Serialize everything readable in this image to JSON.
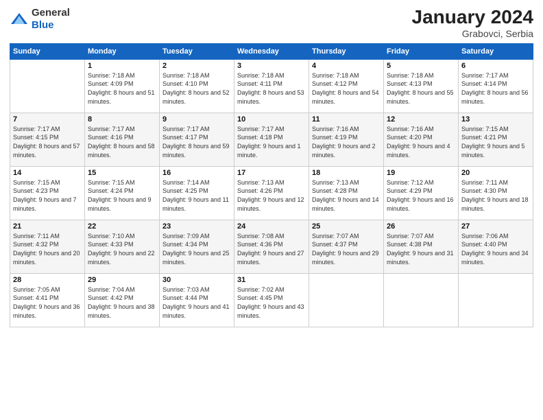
{
  "header": {
    "logo_general": "General",
    "logo_blue": "Blue",
    "month_year": "January 2024",
    "location": "Grabovci, Serbia"
  },
  "weekdays": [
    "Sunday",
    "Monday",
    "Tuesday",
    "Wednesday",
    "Thursday",
    "Friday",
    "Saturday"
  ],
  "weeks": [
    [
      {
        "day": "",
        "sunrise": "",
        "sunset": "",
        "daylight": ""
      },
      {
        "day": "1",
        "sunrise": "Sunrise: 7:18 AM",
        "sunset": "Sunset: 4:09 PM",
        "daylight": "Daylight: 8 hours and 51 minutes."
      },
      {
        "day": "2",
        "sunrise": "Sunrise: 7:18 AM",
        "sunset": "Sunset: 4:10 PM",
        "daylight": "Daylight: 8 hours and 52 minutes."
      },
      {
        "day": "3",
        "sunrise": "Sunrise: 7:18 AM",
        "sunset": "Sunset: 4:11 PM",
        "daylight": "Daylight: 8 hours and 53 minutes."
      },
      {
        "day": "4",
        "sunrise": "Sunrise: 7:18 AM",
        "sunset": "Sunset: 4:12 PM",
        "daylight": "Daylight: 8 hours and 54 minutes."
      },
      {
        "day": "5",
        "sunrise": "Sunrise: 7:18 AM",
        "sunset": "Sunset: 4:13 PM",
        "daylight": "Daylight: 8 hours and 55 minutes."
      },
      {
        "day": "6",
        "sunrise": "Sunrise: 7:17 AM",
        "sunset": "Sunset: 4:14 PM",
        "daylight": "Daylight: 8 hours and 56 minutes."
      }
    ],
    [
      {
        "day": "7",
        "sunrise": "Sunrise: 7:17 AM",
        "sunset": "Sunset: 4:15 PM",
        "daylight": "Daylight: 8 hours and 57 minutes."
      },
      {
        "day": "8",
        "sunrise": "Sunrise: 7:17 AM",
        "sunset": "Sunset: 4:16 PM",
        "daylight": "Daylight: 8 hours and 58 minutes."
      },
      {
        "day": "9",
        "sunrise": "Sunrise: 7:17 AM",
        "sunset": "Sunset: 4:17 PM",
        "daylight": "Daylight: 8 hours and 59 minutes."
      },
      {
        "day": "10",
        "sunrise": "Sunrise: 7:17 AM",
        "sunset": "Sunset: 4:18 PM",
        "daylight": "Daylight: 9 hours and 1 minute."
      },
      {
        "day": "11",
        "sunrise": "Sunrise: 7:16 AM",
        "sunset": "Sunset: 4:19 PM",
        "daylight": "Daylight: 9 hours and 2 minutes."
      },
      {
        "day": "12",
        "sunrise": "Sunrise: 7:16 AM",
        "sunset": "Sunset: 4:20 PM",
        "daylight": "Daylight: 9 hours and 4 minutes."
      },
      {
        "day": "13",
        "sunrise": "Sunrise: 7:15 AM",
        "sunset": "Sunset: 4:21 PM",
        "daylight": "Daylight: 9 hours and 5 minutes."
      }
    ],
    [
      {
        "day": "14",
        "sunrise": "Sunrise: 7:15 AM",
        "sunset": "Sunset: 4:23 PM",
        "daylight": "Daylight: 9 hours and 7 minutes."
      },
      {
        "day": "15",
        "sunrise": "Sunrise: 7:15 AM",
        "sunset": "Sunset: 4:24 PM",
        "daylight": "Daylight: 9 hours and 9 minutes."
      },
      {
        "day": "16",
        "sunrise": "Sunrise: 7:14 AM",
        "sunset": "Sunset: 4:25 PM",
        "daylight": "Daylight: 9 hours and 11 minutes."
      },
      {
        "day": "17",
        "sunrise": "Sunrise: 7:13 AM",
        "sunset": "Sunset: 4:26 PM",
        "daylight": "Daylight: 9 hours and 12 minutes."
      },
      {
        "day": "18",
        "sunrise": "Sunrise: 7:13 AM",
        "sunset": "Sunset: 4:28 PM",
        "daylight": "Daylight: 9 hours and 14 minutes."
      },
      {
        "day": "19",
        "sunrise": "Sunrise: 7:12 AM",
        "sunset": "Sunset: 4:29 PM",
        "daylight": "Daylight: 9 hours and 16 minutes."
      },
      {
        "day": "20",
        "sunrise": "Sunrise: 7:11 AM",
        "sunset": "Sunset: 4:30 PM",
        "daylight": "Daylight: 9 hours and 18 minutes."
      }
    ],
    [
      {
        "day": "21",
        "sunrise": "Sunrise: 7:11 AM",
        "sunset": "Sunset: 4:32 PM",
        "daylight": "Daylight: 9 hours and 20 minutes."
      },
      {
        "day": "22",
        "sunrise": "Sunrise: 7:10 AM",
        "sunset": "Sunset: 4:33 PM",
        "daylight": "Daylight: 9 hours and 22 minutes."
      },
      {
        "day": "23",
        "sunrise": "Sunrise: 7:09 AM",
        "sunset": "Sunset: 4:34 PM",
        "daylight": "Daylight: 9 hours and 25 minutes."
      },
      {
        "day": "24",
        "sunrise": "Sunrise: 7:08 AM",
        "sunset": "Sunset: 4:36 PM",
        "daylight": "Daylight: 9 hours and 27 minutes."
      },
      {
        "day": "25",
        "sunrise": "Sunrise: 7:07 AM",
        "sunset": "Sunset: 4:37 PM",
        "daylight": "Daylight: 9 hours and 29 minutes."
      },
      {
        "day": "26",
        "sunrise": "Sunrise: 7:07 AM",
        "sunset": "Sunset: 4:38 PM",
        "daylight": "Daylight: 9 hours and 31 minutes."
      },
      {
        "day": "27",
        "sunrise": "Sunrise: 7:06 AM",
        "sunset": "Sunset: 4:40 PM",
        "daylight": "Daylight: 9 hours and 34 minutes."
      }
    ],
    [
      {
        "day": "28",
        "sunrise": "Sunrise: 7:05 AM",
        "sunset": "Sunset: 4:41 PM",
        "daylight": "Daylight: 9 hours and 36 minutes."
      },
      {
        "day": "29",
        "sunrise": "Sunrise: 7:04 AM",
        "sunset": "Sunset: 4:42 PM",
        "daylight": "Daylight: 9 hours and 38 minutes."
      },
      {
        "day": "30",
        "sunrise": "Sunrise: 7:03 AM",
        "sunset": "Sunset: 4:44 PM",
        "daylight": "Daylight: 9 hours and 41 minutes."
      },
      {
        "day": "31",
        "sunrise": "Sunrise: 7:02 AM",
        "sunset": "Sunset: 4:45 PM",
        "daylight": "Daylight: 9 hours and 43 minutes."
      },
      {
        "day": "",
        "sunrise": "",
        "sunset": "",
        "daylight": ""
      },
      {
        "day": "",
        "sunrise": "",
        "sunset": "",
        "daylight": ""
      },
      {
        "day": "",
        "sunrise": "",
        "sunset": "",
        "daylight": ""
      }
    ]
  ]
}
